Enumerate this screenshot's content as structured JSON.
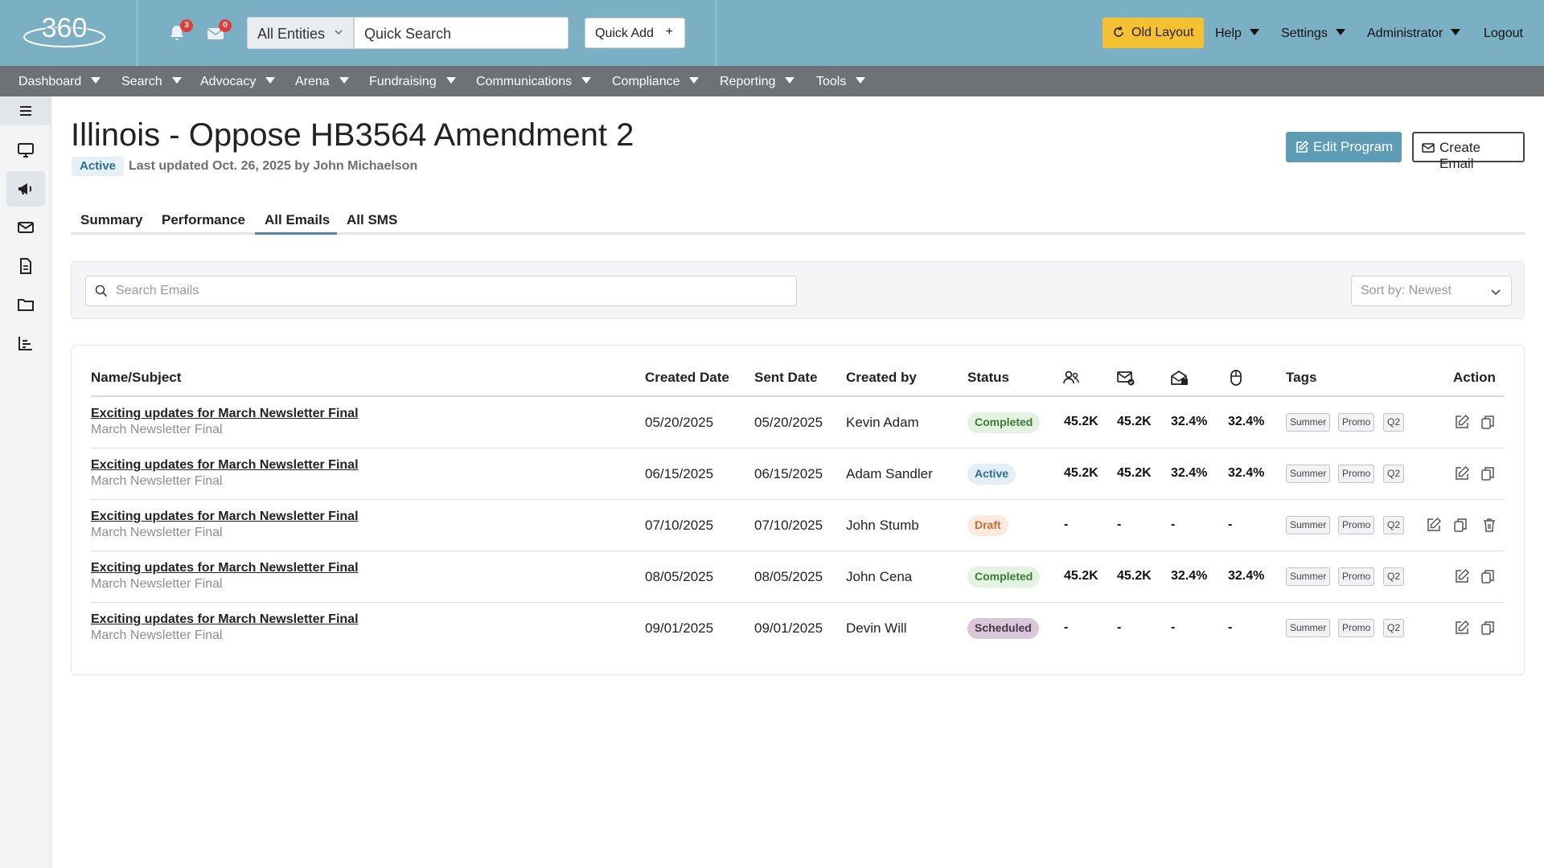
{
  "header": {
    "logo_text": "360",
    "notifications_count": "3",
    "messages_count": "0",
    "entity_select": "All Entities",
    "quick_search": "Quick Search",
    "quick_add": "Quick Add",
    "quick_add_icon": "+",
    "old_layout": "Old Layout",
    "menus": [
      "Help",
      "Settings",
      "Administrator",
      "Logout"
    ],
    "colors": {
      "header_bg": "#7bafc4",
      "old_layout_bg": "#f5c133"
    }
  },
  "nav": {
    "items": [
      "Dashboard",
      "Search",
      "Advocacy",
      "Arena",
      "Fundraising",
      "Communications",
      "Compliance",
      "Reporting",
      "Tools"
    ],
    "bg": "#6d7277"
  },
  "sidebar": {
    "icons": [
      "menu-icon",
      "monitor-icon",
      "megaphone-icon",
      "envelope-icon",
      "document-icon",
      "folder-icon",
      "bar-chart-icon"
    ]
  },
  "page": {
    "title": "Illinois - Oppose HB3564 Amendment 2",
    "status": "Active",
    "last_updated": "Last updated Oct. 26, 2025 by John Michaelson",
    "edit_button": "Edit Program",
    "create_button": "Create Email",
    "tabs": [
      "Summary",
      "Performance",
      "All Emails",
      "All SMS"
    ],
    "active_tab": "All Emails"
  },
  "filters": {
    "search_placeholder": "Search Emails",
    "sort_label": "Sort by: Newest"
  },
  "table": {
    "headers": {
      "name": "Name/Subject",
      "created": "Created Date",
      "sent": "Sent Date",
      "created_by": "Created by",
      "status": "Status",
      "tags": "Tags",
      "action": "Action"
    },
    "metric_icons": [
      "recipients-icon",
      "delivered-icon",
      "opened-icon",
      "clicked-icon"
    ],
    "status_colors": {
      "Completed": {
        "bg": "#e3f2e1",
        "fg": "#3d7a35"
      },
      "Active": {
        "bg": "#e3eff6",
        "fg": "#2b6e92"
      },
      "Draft": {
        "bg": "#fde9dd",
        "fg": "#d0692e"
      },
      "Scheduled": {
        "bg": "#d9c6d8",
        "fg": "#4a3349"
      }
    },
    "rows": [
      {
        "name": "Exciting updates for March Newsletter Final",
        "subject": "March Newsletter Final",
        "created": "05/20/2025",
        "sent": "05/20/2025",
        "created_by": "Kevin Adam",
        "status": "Completed",
        "m1": "45.2K",
        "m2": "45.2K",
        "m3": "32.4%",
        "m4": "32.4%",
        "tags": [
          "Summer",
          "Promo",
          "Q2"
        ],
        "deletable": false
      },
      {
        "name": "Exciting updates for March Newsletter Final",
        "subject": "March Newsletter Final",
        "created": "06/15/2025",
        "sent": "06/15/2025",
        "created_by": "Adam Sandler",
        "status": "Active",
        "m1": "45.2K",
        "m2": "45.2K",
        "m3": "32.4%",
        "m4": "32.4%",
        "tags": [
          "Summer",
          "Promo",
          "Q2"
        ],
        "deletable": false
      },
      {
        "name": "Exciting updates for March Newsletter Final",
        "subject": "March Newsletter Final",
        "created": "07/10/2025",
        "sent": "07/10/2025",
        "created_by": "John Stumb",
        "status": "Draft",
        "m1": "-",
        "m2": "-",
        "m3": "-",
        "m4": "-",
        "tags": [
          "Summer",
          "Promo",
          "Q2"
        ],
        "deletable": true
      },
      {
        "name": "Exciting updates for March Newsletter Final",
        "subject": "March Newsletter Final",
        "created": "08/05/2025",
        "sent": "08/05/2025",
        "created_by": "John Cena",
        "status": "Completed",
        "m1": "45.2K",
        "m2": "45.2K",
        "m3": "32.4%",
        "m4": "32.4%",
        "tags": [
          "Summer",
          "Promo",
          "Q2"
        ],
        "deletable": false
      },
      {
        "name": "Exciting updates for March Newsletter Final",
        "subject": "March Newsletter Final",
        "created": "09/01/2025",
        "sent": "09/01/2025",
        "created_by": "Devin Will",
        "status": "Scheduled",
        "m1": "-",
        "m2": "-",
        "m3": "-",
        "m4": "-",
        "tags": [
          "Summer",
          "Promo",
          "Q2"
        ],
        "deletable": false
      }
    ]
  }
}
